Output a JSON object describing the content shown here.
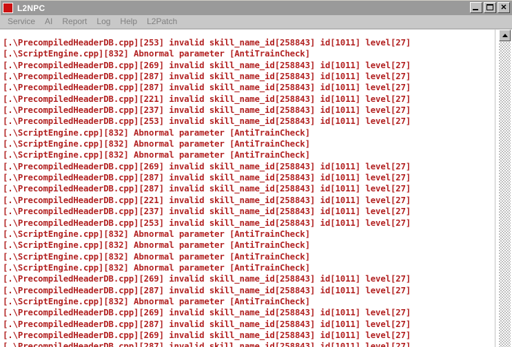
{
  "window": {
    "title": "L2NPC",
    "icon": "app-icon-red-square",
    "minimize_label": "",
    "maximize_label": "",
    "close_label": "✕"
  },
  "menu": {
    "items": [
      {
        "label": "Service"
      },
      {
        "label": "AI"
      },
      {
        "label": "Report"
      },
      {
        "label": "Log"
      },
      {
        "label": "Help"
      },
      {
        "label": "L2Patch"
      }
    ]
  },
  "log": {
    "text_color": "#b22222",
    "background_color": "#ffffff",
    "lines": [
      "[.\\PrecompiledHeaderDB.cpp][253] invalid skill_name_id[258843] id[1011] level[27]",
      "[.\\ScriptEngine.cpp][832] Abnormal parameter [AntiTrainCheck]",
      "[.\\PrecompiledHeaderDB.cpp][269] invalid skill_name_id[258843] id[1011] level[27]",
      "[.\\PrecompiledHeaderDB.cpp][287] invalid skill_name_id[258843] id[1011] level[27]",
      "[.\\PrecompiledHeaderDB.cpp][287] invalid skill_name_id[258843] id[1011] level[27]",
      "[.\\PrecompiledHeaderDB.cpp][221] invalid skill_name_id[258843] id[1011] level[27]",
      "[.\\PrecompiledHeaderDB.cpp][237] invalid skill_name_id[258843] id[1011] level[27]",
      "[.\\PrecompiledHeaderDB.cpp][253] invalid skill_name_id[258843] id[1011] level[27]",
      "[.\\ScriptEngine.cpp][832] Abnormal parameter [AntiTrainCheck]",
      "[.\\ScriptEngine.cpp][832] Abnormal parameter [AntiTrainCheck]",
      "[.\\ScriptEngine.cpp][832] Abnormal parameter [AntiTrainCheck]",
      "[.\\PrecompiledHeaderDB.cpp][269] invalid skill_name_id[258843] id[1011] level[27]",
      "[.\\PrecompiledHeaderDB.cpp][287] invalid skill_name_id[258843] id[1011] level[27]",
      "[.\\PrecompiledHeaderDB.cpp][287] invalid skill_name_id[258843] id[1011] level[27]",
      "[.\\PrecompiledHeaderDB.cpp][221] invalid skill_name_id[258843] id[1011] level[27]",
      "[.\\PrecompiledHeaderDB.cpp][237] invalid skill_name_id[258843] id[1011] level[27]",
      "[.\\PrecompiledHeaderDB.cpp][253] invalid skill_name_id[258843] id[1011] level[27]",
      "[.\\ScriptEngine.cpp][832] Abnormal parameter [AntiTrainCheck]",
      "[.\\ScriptEngine.cpp][832] Abnormal parameter [AntiTrainCheck]",
      "[.\\ScriptEngine.cpp][832] Abnormal parameter [AntiTrainCheck]",
      "[.\\ScriptEngine.cpp][832] Abnormal parameter [AntiTrainCheck]",
      "[.\\PrecompiledHeaderDB.cpp][269] invalid skill_name_id[258843] id[1011] level[27]",
      "[.\\PrecompiledHeaderDB.cpp][287] invalid skill_name_id[258843] id[1011] level[27]",
      "[.\\ScriptEngine.cpp][832] Abnormal parameter [AntiTrainCheck]",
      "[.\\PrecompiledHeaderDB.cpp][269] invalid skill_name_id[258843] id[1011] level[27]",
      "[.\\PrecompiledHeaderDB.cpp][287] invalid skill_name_id[258843] id[1011] level[27]",
      "[.\\PrecompiledHeaderDB.cpp][269] invalid skill_name_id[258843] id[1011] level[27]",
      "[.\\PrecompiledHeaderDB.cpp][287] invalid skill_name_id[258843] id[1011] level[27]"
    ]
  },
  "scrollbar": {
    "up_arrow": "chevron-up-icon",
    "orientation": "vertical"
  }
}
